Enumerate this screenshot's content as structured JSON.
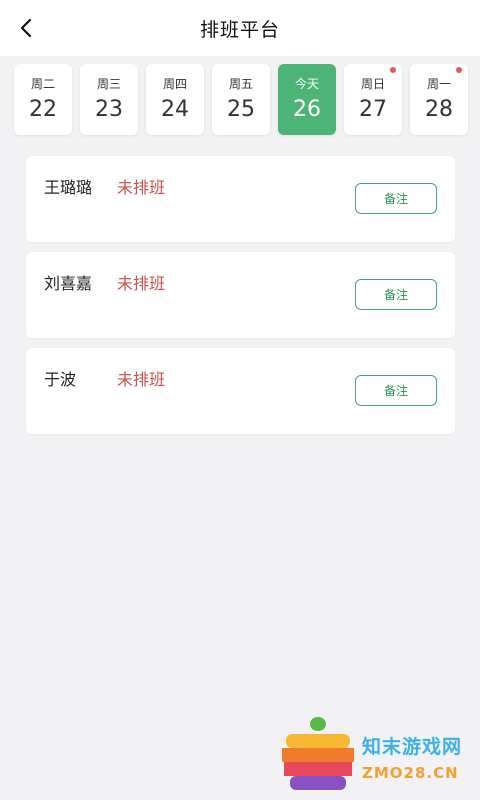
{
  "header": {
    "title": "排班平台"
  },
  "dates": [
    {
      "weekday": "周二",
      "day": "22",
      "active": false,
      "dot": false
    },
    {
      "weekday": "周三",
      "day": "23",
      "active": false,
      "dot": false
    },
    {
      "weekday": "周四",
      "day": "24",
      "active": false,
      "dot": false
    },
    {
      "weekday": "周五",
      "day": "25",
      "active": false,
      "dot": false
    },
    {
      "weekday": "今天",
      "day": "26",
      "active": true,
      "dot": false
    },
    {
      "weekday": "周日",
      "day": "27",
      "active": false,
      "dot": true
    },
    {
      "weekday": "周一",
      "day": "28",
      "active": false,
      "dot": true
    }
  ],
  "staff": [
    {
      "name": "王璐璐",
      "status": "未排班",
      "note_label": "备注"
    },
    {
      "name": "刘喜嘉",
      "status": "未排班",
      "note_label": "备注"
    },
    {
      "name": "于波",
      "status": "未排班",
      "note_label": "备注"
    }
  ],
  "watermark": {
    "cn": "知末游戏网",
    "en": "ZMO28.CN"
  },
  "colors": {
    "accent": "#4cb576",
    "status_red": "#c9504f",
    "dot": "#e05a5a"
  }
}
